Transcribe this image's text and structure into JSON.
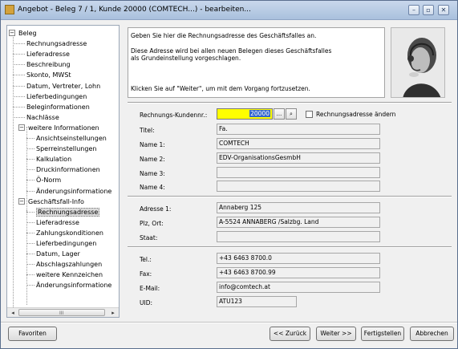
{
  "window": {
    "title": "Angebot - Beleg 7 / 1, Kunde 20000 (COMTECH...) - bearbeiten...",
    "minimize": "–",
    "restore": "▫",
    "close": "✕"
  },
  "tree": {
    "items": [
      {
        "label": "Beleg",
        "expander": "−"
      },
      {
        "label": "Rechnungsadresse"
      },
      {
        "label": "Lieferadresse"
      },
      {
        "label": "Beschreibung"
      },
      {
        "label": "Skonto, MWSt"
      },
      {
        "label": "Datum, Vertreter, Lohn"
      },
      {
        "label": "Lieferbedingungen"
      },
      {
        "label": "Beleginformationen"
      },
      {
        "label": "Nachlässe"
      },
      {
        "label": "weitere Informationen",
        "expander": "−"
      },
      {
        "label": "Ansichtseinstellungen"
      },
      {
        "label": "Sperreinstellungen"
      },
      {
        "label": "Kalkulation"
      },
      {
        "label": "Druckinformationen"
      },
      {
        "label": "Ö-Norm"
      },
      {
        "label": "Änderungsinformatione"
      },
      {
        "label": "Geschäftsfall-Info",
        "expander": "−"
      },
      {
        "label": "Rechnungsadresse",
        "selected": true
      },
      {
        "label": "Lieferadresse"
      },
      {
        "label": "Zahlungskonditionen"
      },
      {
        "label": "Lieferbedingungen"
      },
      {
        "label": "Datum, Lager"
      },
      {
        "label": "Abschlagszahlungen"
      },
      {
        "label": "weitere Kennzeichen"
      },
      {
        "label": "Änderungsinformatione"
      }
    ],
    "scroll_grip": "III",
    "scroll_left": "◂",
    "scroll_right": "▸"
  },
  "info": {
    "line1": "Geben Sie hier die Rechnungsadresse des Geschäftsfalles an.",
    "line2": "Diese Adresse wird bei allen neuen Belegen dieses Geschäftsfalles",
    "line3": "als Grundeinstellung vorgeschlagen.",
    "line4": "Klicken Sie auf \"Weiter\", um mit dem Vorgang fortzusetzen."
  },
  "form": {
    "kundennr_label": "Rechnungs-Kundennr.:",
    "kundennr_value": "20000",
    "browse_btn": "...",
    "search_btn": "⌕",
    "change_address_label": "Rechnungsadresse ändern",
    "titel_label": "Titel:",
    "titel_value": "Fa.",
    "name1_label": "Name 1:",
    "name1_value": "COMTECH",
    "name2_label": "Name 2:",
    "name2_value": "EDV-OrganisationsGesmbH",
    "name3_label": "Name 3:",
    "name3_value": "",
    "name4_label": "Name 4:",
    "name4_value": "",
    "adresse1_label": "Adresse 1:",
    "adresse1_value": "Annaberg 125",
    "plzort_label": "Plz, Ort:",
    "plzort_value": "A-5524 ANNABERG /Salzbg. Land",
    "staat_label": "Staat:",
    "staat_value": "",
    "tel_label": "Tel.:",
    "tel_value": "+43 6463 8700.0",
    "fax_label": "Fax:",
    "fax_value": "+43 6463 8700.99",
    "email_label": "E-Mail:",
    "email_value": "info@comtech.at",
    "uid_label": "UID:",
    "uid_value": "ATU123"
  },
  "buttons": {
    "favoriten": "Favoriten",
    "zurueck": "<< Zurück",
    "weiter": "Weiter >>",
    "fertigstellen": "Fertigstellen",
    "abbrechen": "Abbrechen"
  }
}
